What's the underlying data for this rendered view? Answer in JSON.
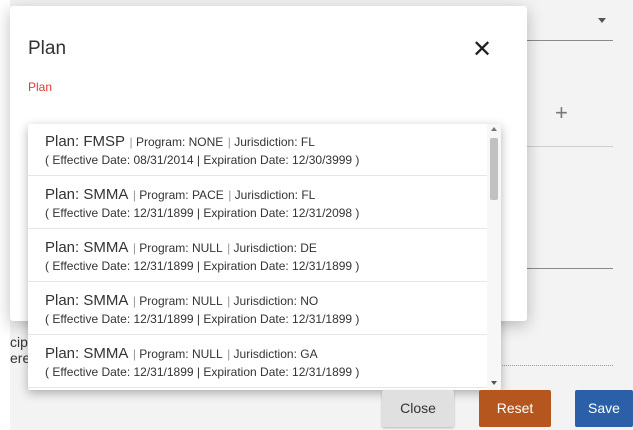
{
  "modal": {
    "title": "Plan",
    "close_glyph": "✕",
    "field_label": "Plan"
  },
  "background": {
    "left_text_1": "cip",
    "left_text_2": "erei",
    "plus_glyph": "+"
  },
  "dropdown": {
    "options": [
      {
        "plan_label": "Plan: FMSP",
        "program": "Program: NONE",
        "jurisdiction": "Jurisdiction: FL",
        "dates": "( Effective Date: 08/31/2014 | Expiration Date: 12/30/3999 )"
      },
      {
        "plan_label": "Plan: SMMA",
        "program": "Program: PACE",
        "jurisdiction": "Jurisdiction: FL",
        "dates": "( Effective Date: 12/31/1899 | Expiration Date: 12/31/2098 )"
      },
      {
        "plan_label": "Plan: SMMA",
        "program": "Program: NULL",
        "jurisdiction": "Jurisdiction: DE",
        "dates": "( Effective Date: 12/31/1899 | Expiration Date: 12/31/1899 )"
      },
      {
        "plan_label": "Plan: SMMA",
        "program": "Program: NULL",
        "jurisdiction": "Jurisdiction: NO",
        "dates": "( Effective Date: 12/31/1899 | Expiration Date: 12/31/1899 )"
      },
      {
        "plan_label": "Plan: SMMA",
        "program": "Program: NULL",
        "jurisdiction": "Jurisdiction: GA",
        "dates": "( Effective Date: 12/31/1899 | Expiration Date: 12/31/1899 )"
      }
    ]
  },
  "footer": {
    "close_label": "Close",
    "reset_label": "Reset",
    "save_label": "Save"
  },
  "colors": {
    "accent_red": "#e53935",
    "reset_orange": "#b5561f",
    "save_blue": "#2b5fa8"
  },
  "icons": [
    "close-icon",
    "plus-icon",
    "caret-down-icon",
    "scroll-up-arrow-icon",
    "scroll-down-arrow-icon"
  ]
}
